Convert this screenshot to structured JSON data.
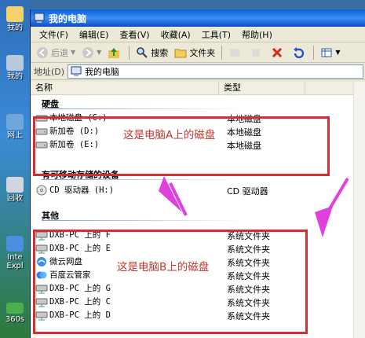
{
  "desktop": {
    "icons": [
      {
        "label": "我的"
      },
      {
        "label": "我的"
      },
      {
        "label": "网上"
      },
      {
        "label": "回收"
      },
      {
        "label": "Inte"
      },
      {
        "label": "Expl"
      },
      {
        "label": "360s"
      }
    ]
  },
  "window": {
    "title": "我的电脑",
    "menu": [
      "文件(F)",
      "编辑(E)",
      "查看(V)",
      "收藏(A)",
      "工具(T)",
      "帮助(H)"
    ],
    "toolbar": {
      "back": "后退",
      "search": "搜索",
      "folders": "文件夹"
    },
    "address": {
      "label": "地址(D)",
      "value": "我的电脑"
    }
  },
  "columns": {
    "name": "名称",
    "type": "类型"
  },
  "groups": {
    "hard_disks": "硬盘",
    "removable": "有可移动存储的设备",
    "other": "其他"
  },
  "hard_disks": [
    {
      "name": "本地磁盘 (C:)",
      "type": "本地磁盘"
    },
    {
      "name": "新加卷 (D:)",
      "type": "本地磁盘"
    },
    {
      "name": "新加卷 (E:)",
      "type": "本地磁盘"
    }
  ],
  "removable": [
    {
      "name": "CD 驱动器 (H:)",
      "type": "CD 驱动器"
    }
  ],
  "other": [
    {
      "name": "DXB-PC 上的 F",
      "type": "系统文件夹"
    },
    {
      "name": "DXB-PC 上的 E",
      "type": "系统文件夹"
    },
    {
      "name": "微云网盘",
      "type": "系统文件夹"
    },
    {
      "name": "百度云管家",
      "type": "系统文件夹"
    },
    {
      "name": "DXB-PC 上的 G",
      "type": "系统文件夹"
    },
    {
      "name": "DXB-PC 上的 C",
      "type": "系统文件夹"
    },
    {
      "name": "DXB-PC 上的 D",
      "type": "系统文件夹"
    }
  ],
  "annotations": {
    "a": "这是电脑A上的磁盘",
    "b": "这是电脑B上的磁盘"
  },
  "colors": {
    "annotation_box": "#d23030",
    "arrow": "#e040e0"
  }
}
